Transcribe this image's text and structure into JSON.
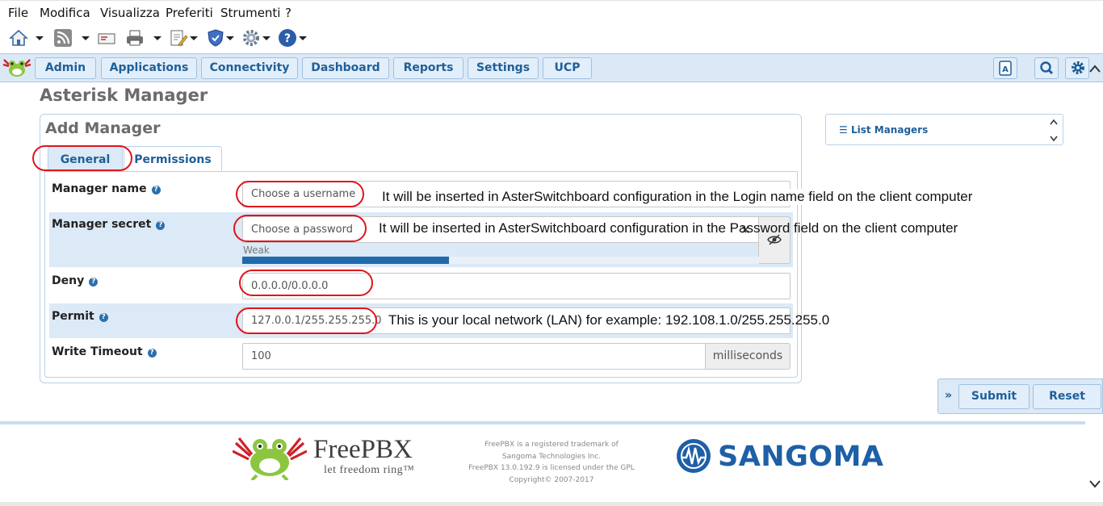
{
  "menu": [
    "File",
    "Modifica",
    "Visualizza",
    "Preferiti",
    "Strumenti",
    "?"
  ],
  "toolbar_icons": [
    "home-icon",
    "rss-feed-icon",
    "mail-icon",
    "print-icon",
    "page-edit-icon",
    "security-shield-icon",
    "settings-gear-icon",
    "help-icon"
  ],
  "nav": [
    "Admin",
    "Applications",
    "Connectivity",
    "Dashboard",
    "Reports",
    "Settings",
    "UCP"
  ],
  "nav_icons": [
    "translate-icon",
    "search-icon",
    "gear-icon"
  ],
  "page_title": "Asterisk Manager",
  "panel_title": "Add Manager",
  "tabs": [
    "General",
    "Permissions"
  ],
  "form": {
    "manager_name": {
      "label": "Manager name",
      "placeholder": "Choose a username"
    },
    "manager_secret": {
      "label": "Manager secret",
      "placeholder": "Choose a password",
      "strength_label": "Weak",
      "strength_fraction": 0.4
    },
    "deny": {
      "label": "Deny",
      "value": "0.0.0.0/0.0.0.0"
    },
    "permit": {
      "label": "Permit",
      "value": "127.0.0.1/255.255.255.0"
    },
    "write_timeout": {
      "label": "Write Timeout",
      "value": "100",
      "unit": "milliseconds"
    }
  },
  "annotations": {
    "username": "It will be inserted in AsterSwitchboard configuration in the Login name field on the client computer",
    "password": "It will be inserted in AsterSwitchboard configuration in the Password field on the client computer",
    "permit": "This is your local network (LAN) for example: 192.108.1.0/255.255.255.0"
  },
  "list_managers": "List Managers",
  "actions": {
    "submit": "Submit",
    "reset": "Reset"
  },
  "footer": {
    "brand": "FreePBX",
    "tagline": "let freedom ring™",
    "legal": [
      "FreePBX is a registered trademark of",
      "Sangoma Technologies Inc.",
      "FreePBX 13.0.192.9 is licensed under the GPL",
      "Copyright© 2007-2017"
    ],
    "sangoma": "SANGOMA"
  },
  "colors": {
    "accent": "#1f5f98",
    "nav_bg": "#dbe9f7",
    "annotation_red": "#e0141b"
  }
}
